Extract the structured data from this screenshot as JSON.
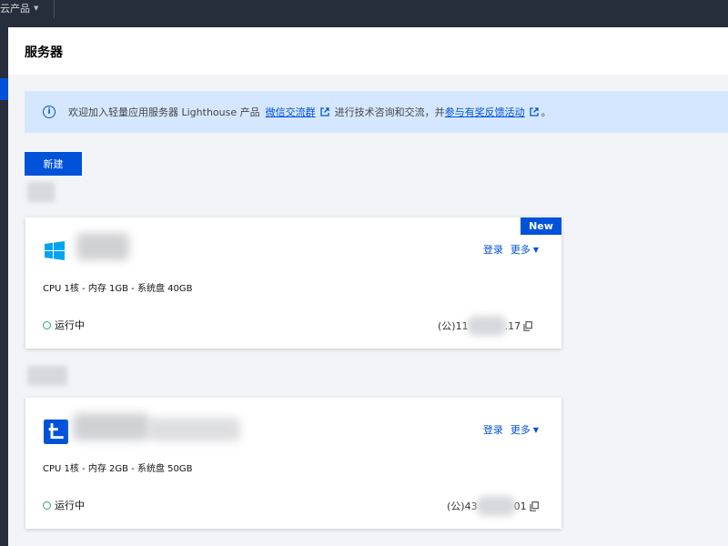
{
  "topnav": {
    "product_menu": "云产品"
  },
  "page": {
    "title": "服务器"
  },
  "notice": {
    "text_before": "欢迎加入轻量应用服务器 Lighthouse 产品",
    "link1": "微信交流群",
    "text_middle": "进行技术咨询和交流，并",
    "link2": "参与有奖反馈活动",
    "text_end": "。"
  },
  "toolbar": {
    "new_label": "新建"
  },
  "instances": [
    {
      "os": "windows",
      "badge": "New",
      "login_label": "登录",
      "more_label": "更多",
      "spec": "CPU 1核 - 内存 1GB - 系统盘 40GB",
      "status": "运行中",
      "ip_prefix": "(公)11",
      "ip_suffix": ".17"
    },
    {
      "os": "lighthouse",
      "login_label": "登录",
      "more_label": "更多",
      "spec": "CPU 1核 - 内存 2GB - 系统盘 50GB",
      "status": "运行中",
      "ip_prefix": "(公)43",
      "ip_suffix": "01"
    }
  ],
  "colors": {
    "brand": "#0052d9",
    "topbar": "#262e3b",
    "notice_bg": "#d5e7ff",
    "running": "#2ba471"
  },
  "icons": [
    "info-icon",
    "external-link-icon",
    "windows-logo-icon",
    "lighthouse-logo-icon",
    "copy-icon",
    "running-status-icon",
    "chevron-down-icon"
  ]
}
